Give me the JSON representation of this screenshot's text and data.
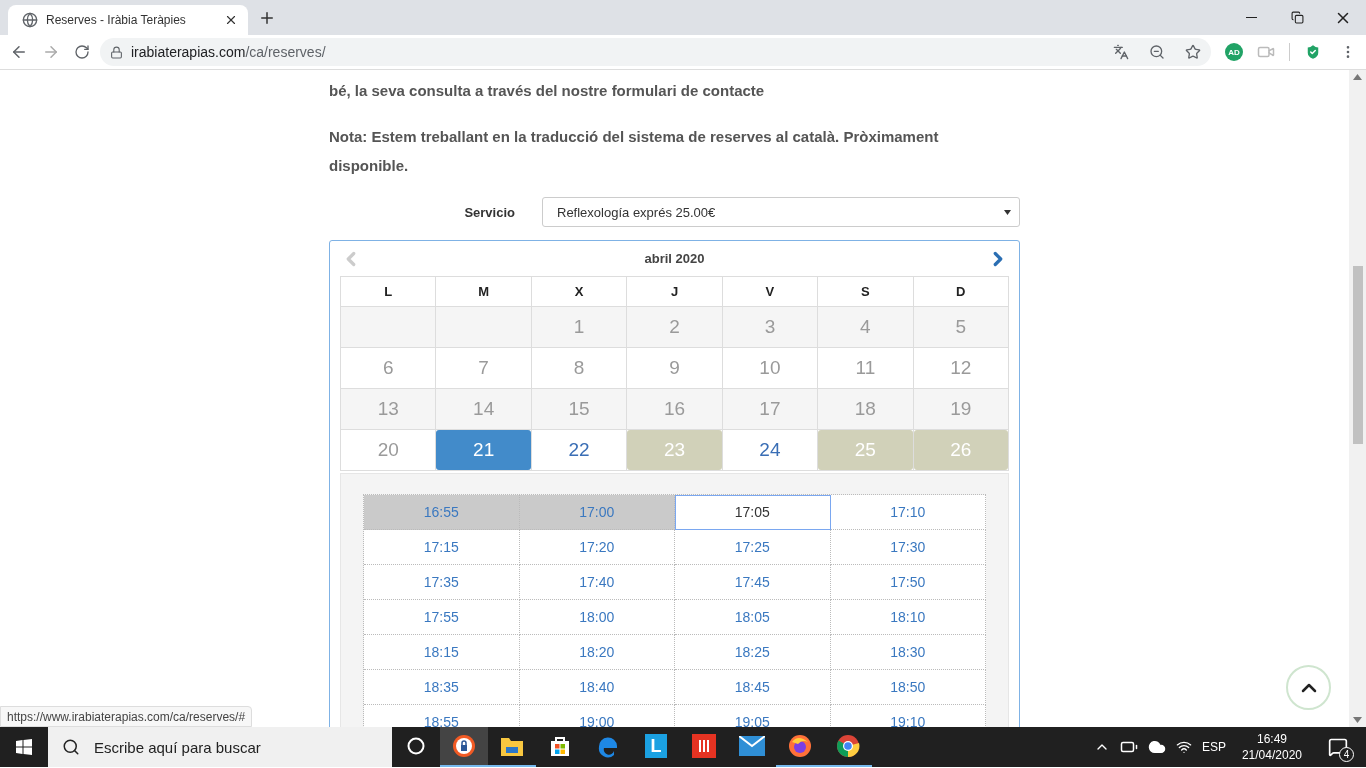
{
  "browser": {
    "tab_title": "Reserves - Iràbia Teràpies",
    "url_host": "irabiaterapias.com",
    "url_path": "/ca/reserves/",
    "extension_badge": "AD",
    "forward_disabled": true
  },
  "page": {
    "intro_tail": "bé, la seva consulta a través del nostre formulari de contacte",
    "note": "Nota: Estem treballant en la traducció del sistema de reserves al català. Pròximament disponible.",
    "service": {
      "label": "Servicio",
      "value": "Reflexología exprés 25.00€"
    },
    "calendar": {
      "title": "abril 2020",
      "prev_disabled": true,
      "weekdays": [
        "L",
        "M",
        "X",
        "J",
        "V",
        "S",
        "D"
      ],
      "weeks": [
        [
          {
            "kind": "empty"
          },
          {
            "kind": "empty"
          },
          {
            "day": "1",
            "kind": "past"
          },
          {
            "day": "2",
            "kind": "past"
          },
          {
            "day": "3",
            "kind": "past"
          },
          {
            "day": "4",
            "kind": "past"
          },
          {
            "day": "5",
            "kind": "past"
          }
        ],
        [
          {
            "day": "6",
            "kind": "past"
          },
          {
            "day": "7",
            "kind": "past"
          },
          {
            "day": "8",
            "kind": "past"
          },
          {
            "day": "9",
            "kind": "past"
          },
          {
            "day": "10",
            "kind": "past"
          },
          {
            "day": "11",
            "kind": "past"
          },
          {
            "day": "12",
            "kind": "past"
          }
        ],
        [
          {
            "day": "13",
            "kind": "past"
          },
          {
            "day": "14",
            "kind": "past"
          },
          {
            "day": "15",
            "kind": "past"
          },
          {
            "day": "16",
            "kind": "past"
          },
          {
            "day": "17",
            "kind": "past"
          },
          {
            "day": "18",
            "kind": "past"
          },
          {
            "day": "19",
            "kind": "past"
          }
        ],
        [
          {
            "day": "20",
            "kind": "past"
          },
          {
            "day": "21",
            "kind": "selected"
          },
          {
            "day": "22",
            "kind": "available"
          },
          {
            "day": "23",
            "kind": "full"
          },
          {
            "day": "24",
            "kind": "available"
          },
          {
            "day": "25",
            "kind": "full"
          },
          {
            "day": "26",
            "kind": "full"
          }
        ]
      ]
    },
    "time_slots": [
      [
        {
          "time": "16:55",
          "disabled": true,
          "selected": false
        },
        {
          "time": "17:00",
          "disabled": true,
          "selected": false
        },
        {
          "time": "17:05",
          "disabled": false,
          "selected": true
        },
        {
          "time": "17:10",
          "disabled": false,
          "selected": false
        }
      ],
      [
        {
          "time": "17:15",
          "disabled": false,
          "selected": false
        },
        {
          "time": "17:20",
          "disabled": false,
          "selected": false
        },
        {
          "time": "17:25",
          "disabled": false,
          "selected": false
        },
        {
          "time": "17:30",
          "disabled": false,
          "selected": false
        }
      ],
      [
        {
          "time": "17:35",
          "disabled": false,
          "selected": false
        },
        {
          "time": "17:40",
          "disabled": false,
          "selected": false
        },
        {
          "time": "17:45",
          "disabled": false,
          "selected": false
        },
        {
          "time": "17:50",
          "disabled": false,
          "selected": false
        }
      ],
      [
        {
          "time": "17:55",
          "disabled": false,
          "selected": false
        },
        {
          "time": "18:00",
          "disabled": false,
          "selected": false
        },
        {
          "time": "18:05",
          "disabled": false,
          "selected": false
        },
        {
          "time": "18:10",
          "disabled": false,
          "selected": false
        }
      ],
      [
        {
          "time": "18:15",
          "disabled": false,
          "selected": false
        },
        {
          "time": "18:20",
          "disabled": false,
          "selected": false
        },
        {
          "time": "18:25",
          "disabled": false,
          "selected": false
        },
        {
          "time": "18:30",
          "disabled": false,
          "selected": false
        }
      ],
      [
        {
          "time": "18:35",
          "disabled": false,
          "selected": false
        },
        {
          "time": "18:40",
          "disabled": false,
          "selected": false
        },
        {
          "time": "18:45",
          "disabled": false,
          "selected": false
        },
        {
          "time": "18:50",
          "disabled": false,
          "selected": false
        }
      ],
      [
        {
          "time": "18:55",
          "disabled": false,
          "selected": false
        },
        {
          "time": "19:00",
          "disabled": false,
          "selected": false
        },
        {
          "time": "19:05",
          "disabled": false,
          "selected": false
        },
        {
          "time": "19:10",
          "disabled": false,
          "selected": false
        }
      ]
    ]
  },
  "status_link": "https://www.irabiaterapias.com/ca/reserves/#",
  "taskbar": {
    "search_placeholder": "Escribe aquí para buscar",
    "apps": [
      {
        "kind": "lock-browser",
        "running": true,
        "selected": true
      },
      {
        "kind": "folder",
        "running": true,
        "selected": false
      },
      {
        "kind": "store",
        "running": false,
        "selected": false
      },
      {
        "kind": "edge",
        "running": false,
        "selected": false
      },
      {
        "kind": "letter-tile",
        "label": "L",
        "running": false,
        "selected": false
      },
      {
        "kind": "bars",
        "running": false,
        "selected": false
      },
      {
        "kind": "mail",
        "running": false,
        "selected": false
      },
      {
        "kind": "firefox",
        "running": true,
        "selected": false
      },
      {
        "kind": "chrome",
        "running": true,
        "selected": false
      }
    ],
    "language": "ESP",
    "time": "16:49",
    "date": "21/04/2020",
    "notifications": "4"
  }
}
